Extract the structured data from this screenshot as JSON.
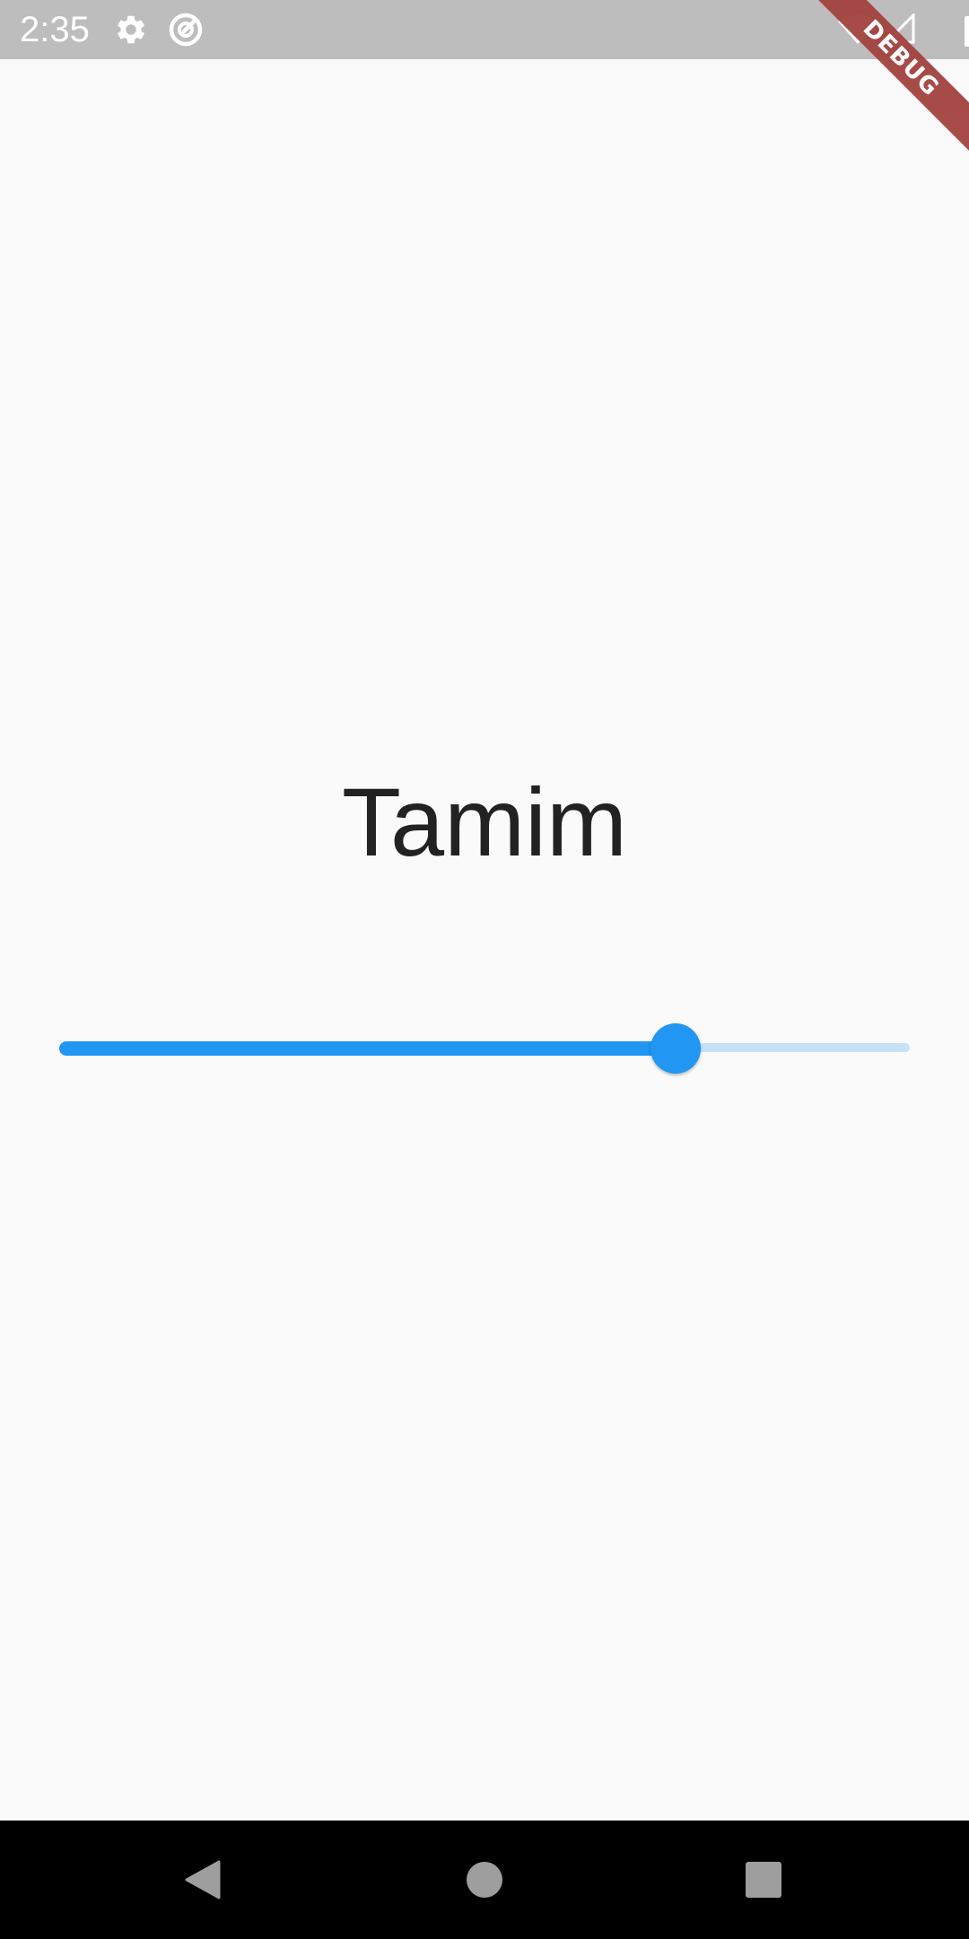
{
  "status_bar": {
    "time": "2:35",
    "icons": [
      "gear-icon",
      "sync-icon",
      "wifi-icon",
      "signal-icon",
      "battery-icon"
    ]
  },
  "debug_banner": {
    "label": "DEBUG",
    "color": "#a3423f"
  },
  "main": {
    "title": "Tamim",
    "slider": {
      "value": 0.725,
      "active_color": "#2196f3",
      "inactive_color": "#c6e2f9"
    }
  },
  "nav_bar": {
    "buttons": [
      "back-icon",
      "home-icon",
      "recents-icon"
    ]
  },
  "colors": {
    "background": "#fafafa",
    "status_bar": "#bdbdbd",
    "nav_bar": "#000000",
    "text": "#222222"
  }
}
